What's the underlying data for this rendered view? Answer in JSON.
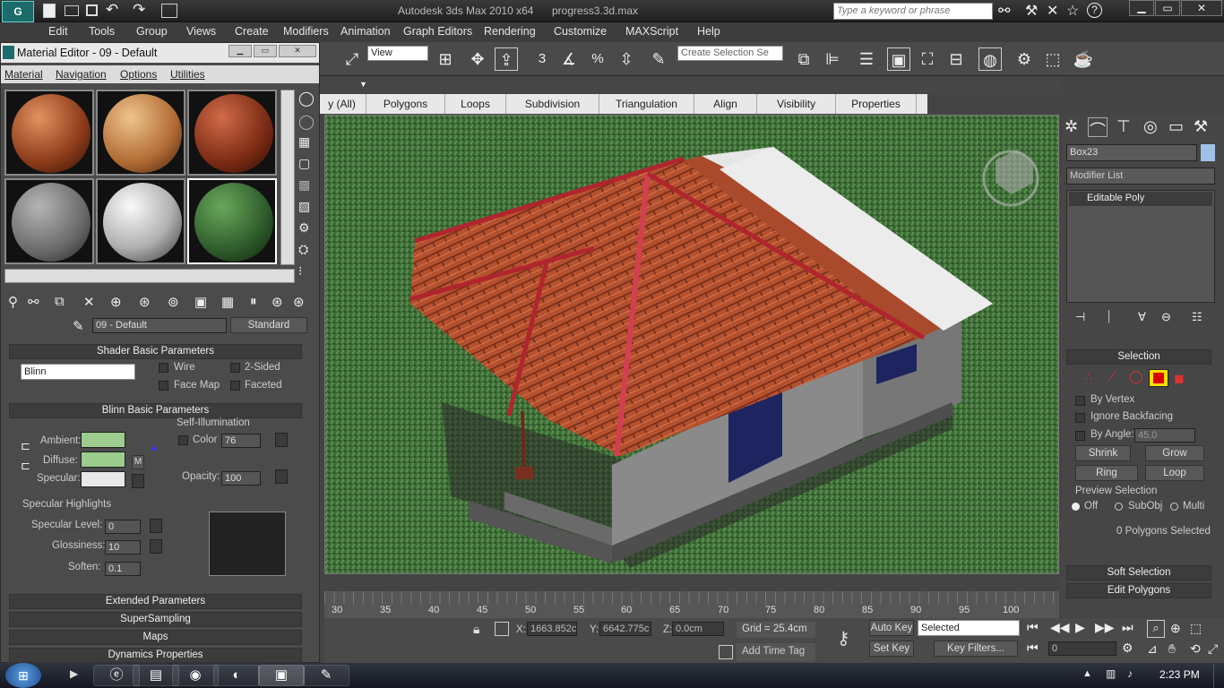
{
  "app": {
    "title": "Autodesk 3ds Max  2010 x64",
    "file": "progress3.3d.max",
    "search_placeholder": "Type a keyword or phrase",
    "logo_text": "G"
  },
  "menu": [
    "Edit",
    "Tools",
    "Group",
    "Views",
    "Create",
    "Modifiers",
    "Animation",
    "Graph Editors",
    "Rendering",
    "Customize",
    "MAXScript",
    "Help"
  ],
  "toolbar": {
    "view_dropdown": "View",
    "selection_set": "Create Selection Se",
    "numbers": [
      "3",
      "%"
    ]
  },
  "ribbon_tabs": [
    "y (All)",
    "Polygons",
    "Loops",
    "Subdivision",
    "Triangulation",
    "Align",
    "Visibility",
    "Properties"
  ],
  "material_editor": {
    "title": "Material Editor - 09 - Default",
    "menu": [
      "Material",
      "Navigation",
      "Options",
      "Utilities"
    ],
    "material_name": "09 - Default",
    "type_button": "Standard",
    "shader_rollout": "Shader Basic Parameters",
    "shader": "Blinn",
    "checks": [
      "Wire",
      "2-Sided",
      "Face Map",
      "Faceted"
    ],
    "blinn_rollout": "Blinn Basic Parameters",
    "self_illum_label": "Self-Illumination",
    "color_label": "Color",
    "color_value": "76",
    "ambient": "Ambient:",
    "diffuse": "Diffuse:",
    "specular": "Specular:",
    "map_button": "M",
    "opacity_label": "Opacity:",
    "opacity": "100",
    "spec_highlights": "Specular Highlights",
    "spec_level_label": "Specular Level:",
    "spec_level": "0",
    "glossiness_label": "Glossiness:",
    "glossiness": "10",
    "soften_label": "Soften:",
    "soften": "0.1",
    "rollouts": [
      "Extended Parameters",
      "SuperSampling",
      "Maps",
      "Dynamics Properties"
    ],
    "colors": {
      "ambient": "#9ccc8e",
      "diffuse": "#9ccc8e",
      "specular": "#e8e8e8"
    }
  },
  "command_panel": {
    "object_name": "Box23",
    "modifier_list": "Modifier List",
    "stack_item": "Editable Poly",
    "selection_title": "Selection",
    "by_vertex": "By Vertex",
    "ignore_backfacing": "Ignore Backfacing",
    "by_angle": "By Angle:",
    "angle": "45.0",
    "shrink": "Shrink",
    "grow": "Grow",
    "ring": "Ring",
    "loop": "Loop",
    "preview": "Preview Selection",
    "off": "Off",
    "subobj": "SubObj",
    "multi": "Multi",
    "status": "0 Polygons Selected",
    "soft_selection": "Soft Selection",
    "edit_polygons": "Edit Polygons"
  },
  "timeline": {
    "ticks": [
      "30",
      "35",
      "40",
      "45",
      "50",
      "55",
      "60",
      "65",
      "70",
      "75",
      "80",
      "85",
      "90",
      "95",
      "100"
    ]
  },
  "status": {
    "x_label": "X:",
    "x": "1663.852c",
    "y_label": "Y:",
    "y": "6642.775c",
    "z_label": "Z:",
    "z": "0.0cm",
    "grid": "Grid = 25.4cm",
    "add_time_tag": "Add Time Tag",
    "auto_key": "Auto Key",
    "set_key": "Set Key",
    "selected": "Selected",
    "key_filters": "Key Filters...",
    "frame": "0"
  },
  "taskbar": {
    "clock": "2:23 PM"
  }
}
